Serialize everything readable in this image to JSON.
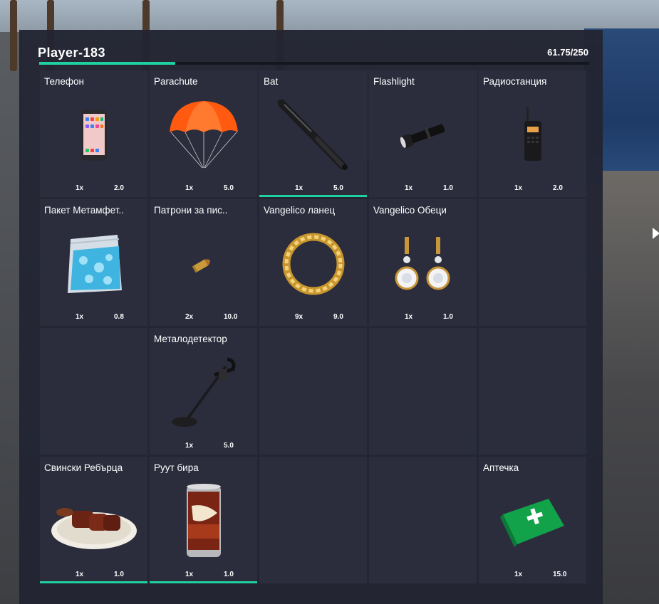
{
  "header": {
    "player_name": "Player-183",
    "weight_text": "61.75/250",
    "weight_fraction": 0.247,
    "accent_color": "#1fd1a0"
  },
  "slots": [
    {
      "name": "Телефон",
      "count": "1x",
      "weight": "2.0",
      "icon": "smartphone-icon",
      "selected": false
    },
    {
      "name": "Parachute",
      "count": "1x",
      "weight": "5.0",
      "icon": "parachute-icon",
      "selected": false
    },
    {
      "name": "Bat",
      "count": "1x",
      "weight": "5.0",
      "icon": "baseball-bat-icon",
      "selected": true
    },
    {
      "name": "Flashlight",
      "count": "1x",
      "weight": "1.0",
      "icon": "flashlight-icon",
      "selected": false
    },
    {
      "name": "Радиостанция",
      "count": "1x",
      "weight": "2.0",
      "icon": "radio-icon",
      "selected": false
    },
    {
      "name": "Пакет Метамфет..",
      "count": "1x",
      "weight": "0.8",
      "icon": "meth-bag-icon",
      "selected": false
    },
    {
      "name": "Патрони за пис..",
      "count": "2x",
      "weight": "10.0",
      "icon": "bullet-icon",
      "selected": false
    },
    {
      "name": "Vangelico ланец",
      "count": "9x",
      "weight": "9.0",
      "icon": "gold-chain-icon",
      "selected": false
    },
    {
      "name": "Vangelico Обеци",
      "count": "1x",
      "weight": "1.0",
      "icon": "earrings-icon",
      "selected": false
    },
    {
      "name": "",
      "count": "",
      "weight": "",
      "icon": "",
      "selected": false
    },
    {
      "name": "",
      "count": "",
      "weight": "",
      "icon": "",
      "selected": false
    },
    {
      "name": "Металодетектор",
      "count": "1x",
      "weight": "5.0",
      "icon": "metal-detector-icon",
      "selected": false
    },
    {
      "name": "",
      "count": "",
      "weight": "",
      "icon": "",
      "selected": false
    },
    {
      "name": "",
      "count": "",
      "weight": "",
      "icon": "",
      "selected": false
    },
    {
      "name": "",
      "count": "",
      "weight": "",
      "icon": "",
      "selected": false
    },
    {
      "name": "Свински Ребърца",
      "count": "1x",
      "weight": "1.0",
      "icon": "ribs-plate-icon",
      "selected": true
    },
    {
      "name": "Руут бира",
      "count": "1x",
      "weight": "1.0",
      "icon": "beer-can-icon",
      "selected": true
    },
    {
      "name": "",
      "count": "",
      "weight": "",
      "icon": "",
      "selected": false
    },
    {
      "name": "",
      "count": "",
      "weight": "",
      "icon": "",
      "selected": false
    },
    {
      "name": "Аптечка",
      "count": "1x",
      "weight": "15.0",
      "icon": "first-aid-kit-icon",
      "selected": false
    }
  ]
}
